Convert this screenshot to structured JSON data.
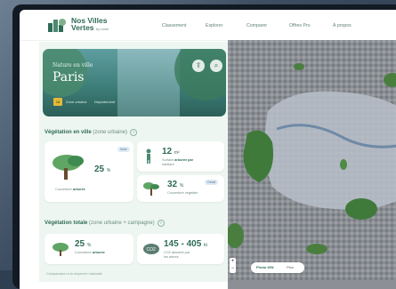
{
  "brand": {
    "name_line1": "Nos Villes",
    "name_line2": "Vertes",
    "tagline": "by namr"
  },
  "nav": {
    "items": [
      "Classement",
      "Explorer",
      "Comparer",
      "Offres Pro",
      "À propos"
    ]
  },
  "hero": {
    "pre_title": "Nature en ville",
    "city": "Paris",
    "badge": "18",
    "meta1": "Zone urbaine",
    "meta2": "Département",
    "share_icon": "share-icon",
    "search_icon": "search-icon"
  },
  "urban": {
    "title": "Végétation en ville",
    "subtitle": "(zone urbaine)",
    "main": {
      "pill": "Note",
      "value": "25",
      "unit": "%",
      "label_prefix": "Couverture",
      "label_bold": "arborée"
    },
    "trees": {
      "value": "12",
      "unit": "m²",
      "label_line1": "Surface",
      "label_bold": "arborée par",
      "label_line2": "habitant"
    },
    "veg": {
      "pill": "Détail",
      "value": "32",
      "unit": "%",
      "label": "Couverture végétale"
    }
  },
  "total": {
    "title": "Végétation totale",
    "subtitle": "(zone urbaine + campagne)",
    "cover": {
      "value": "25",
      "unit": "%",
      "label_prefix": "Couverture",
      "label_bold": "arborée"
    },
    "co2": {
      "value": "145 - 405",
      "unit": "kt",
      "label": "CO2 absorbé par",
      "label2": "les arbres"
    }
  },
  "footer": "Comparaison à la moyenne nationale",
  "map": {
    "photo_label": "Photo IGN",
    "plan_label": "Plan",
    "zoom_in": "+",
    "zoom_out": "−"
  },
  "colors": {
    "accent": "#2f6b57",
    "panel": "#eef6f1",
    "pill": "#dfeaf4"
  }
}
